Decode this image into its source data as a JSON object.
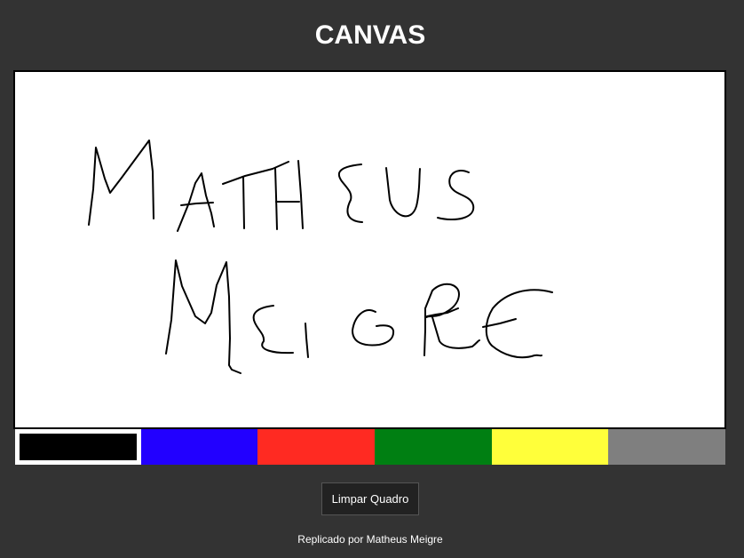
{
  "header": {
    "title": "CANVAS"
  },
  "canvas": {
    "background": "#ffffff",
    "stroke_color": "#000000"
  },
  "palette": {
    "selected_index": 0,
    "colors": [
      "#000000",
      "#2200ff",
      "#ff2a22",
      "#007f12",
      "#ffff3a",
      "#7f7f7f"
    ]
  },
  "actions": {
    "clear_label": "Limpar Quadro"
  },
  "footer": {
    "credit": "Replicado por Matheus Meigre"
  }
}
